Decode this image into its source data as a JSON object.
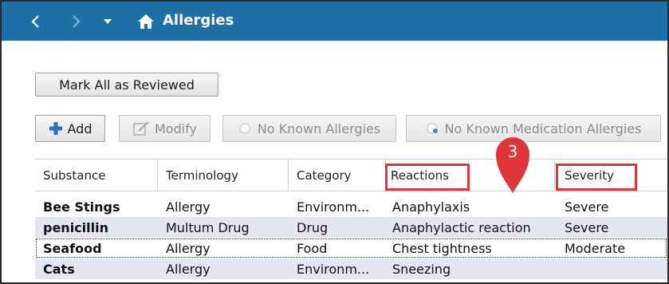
{
  "window": {
    "title": "Allergies"
  },
  "nav": {
    "back_icon": "chevron-left-icon",
    "forward_icon": "chevron-right-icon",
    "dropdown_icon": "caret-down-icon",
    "home_icon": "home-icon"
  },
  "toolbar": {
    "mark_all_label": "Mark All as Reviewed",
    "add_label": "Add",
    "modify_label": "Modify",
    "nka_label": "No Known Allergies",
    "nkma_label": "No Known Medication Allergies"
  },
  "table": {
    "columns": [
      "Substance",
      "Terminology",
      "Category",
      "Reactions",
      "Severity"
    ],
    "rows": [
      {
        "substance": "Bee Stings",
        "terminology": "Allergy",
        "category": "Environm...",
        "reactions": "Anaphylaxis",
        "severity": "Severe"
      },
      {
        "substance": "penicillin",
        "terminology": "Multum Drug",
        "category": "Drug",
        "reactions": "Anaphylactic reaction",
        "severity": "Severe"
      },
      {
        "substance": "Seafood",
        "terminology": "Allergy",
        "category": "Food",
        "reactions": "Chest tightness",
        "severity": "Moderate"
      },
      {
        "substance": "Cats",
        "terminology": "Allergy",
        "category": "Environm...",
        "reactions": "Sneezing",
        "severity": ""
      }
    ]
  },
  "callout": {
    "number": "3"
  },
  "colors": {
    "titlebar": "#1d6fa6",
    "row_alt": "#e4e6f1",
    "highlight": "#e0353a",
    "add_icon": "#2e6fc4"
  }
}
